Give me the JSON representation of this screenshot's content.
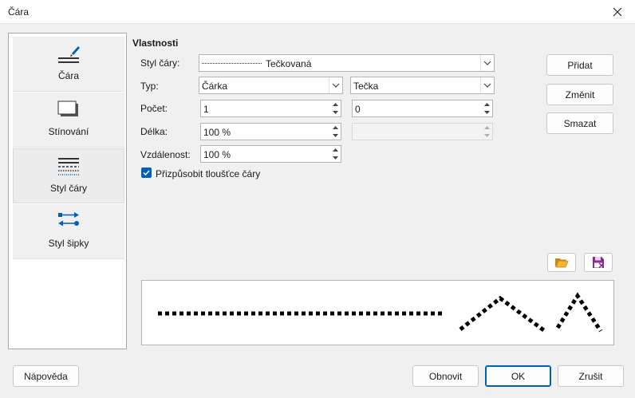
{
  "window": {
    "title": "Čára"
  },
  "sidebar": {
    "items": [
      {
        "label": "Čára",
        "icon": "line-pencil-icon"
      },
      {
        "label": "Stínování",
        "icon": "shadow-icon"
      },
      {
        "label": "Styl čáry",
        "icon": "line-style-icon"
      },
      {
        "label": "Styl šipky",
        "icon": "arrow-style-icon"
      }
    ]
  },
  "properties": {
    "title": "Vlastnosti",
    "line_style_label": "Styl čáry:",
    "line_style_value": "Tečkovaná",
    "type_label": "Typ:",
    "type1_value": "Čárka",
    "type2_value": "Tečka",
    "count_label": "Počet:",
    "count1_value": "1",
    "count2_value": "0",
    "length_label": "Délka:",
    "length1_value": "100 %",
    "length2_value": "",
    "spacing_label": "Vzdálenost:",
    "spacing_value": "100 %",
    "fit_checkbox_label": "Přizpůsobit tloušťce čáry",
    "fit_checked": true
  },
  "actions": {
    "add": "Přidat",
    "modify": "Změnit",
    "delete": "Smazat"
  },
  "footer": {
    "help": "Nápověda",
    "reset": "Obnovit",
    "ok": "OK",
    "cancel": "Zrušit"
  },
  "colors": {
    "accent": "#005fb8",
    "folder": "#e0a21a",
    "save": "#8a2b8f"
  }
}
